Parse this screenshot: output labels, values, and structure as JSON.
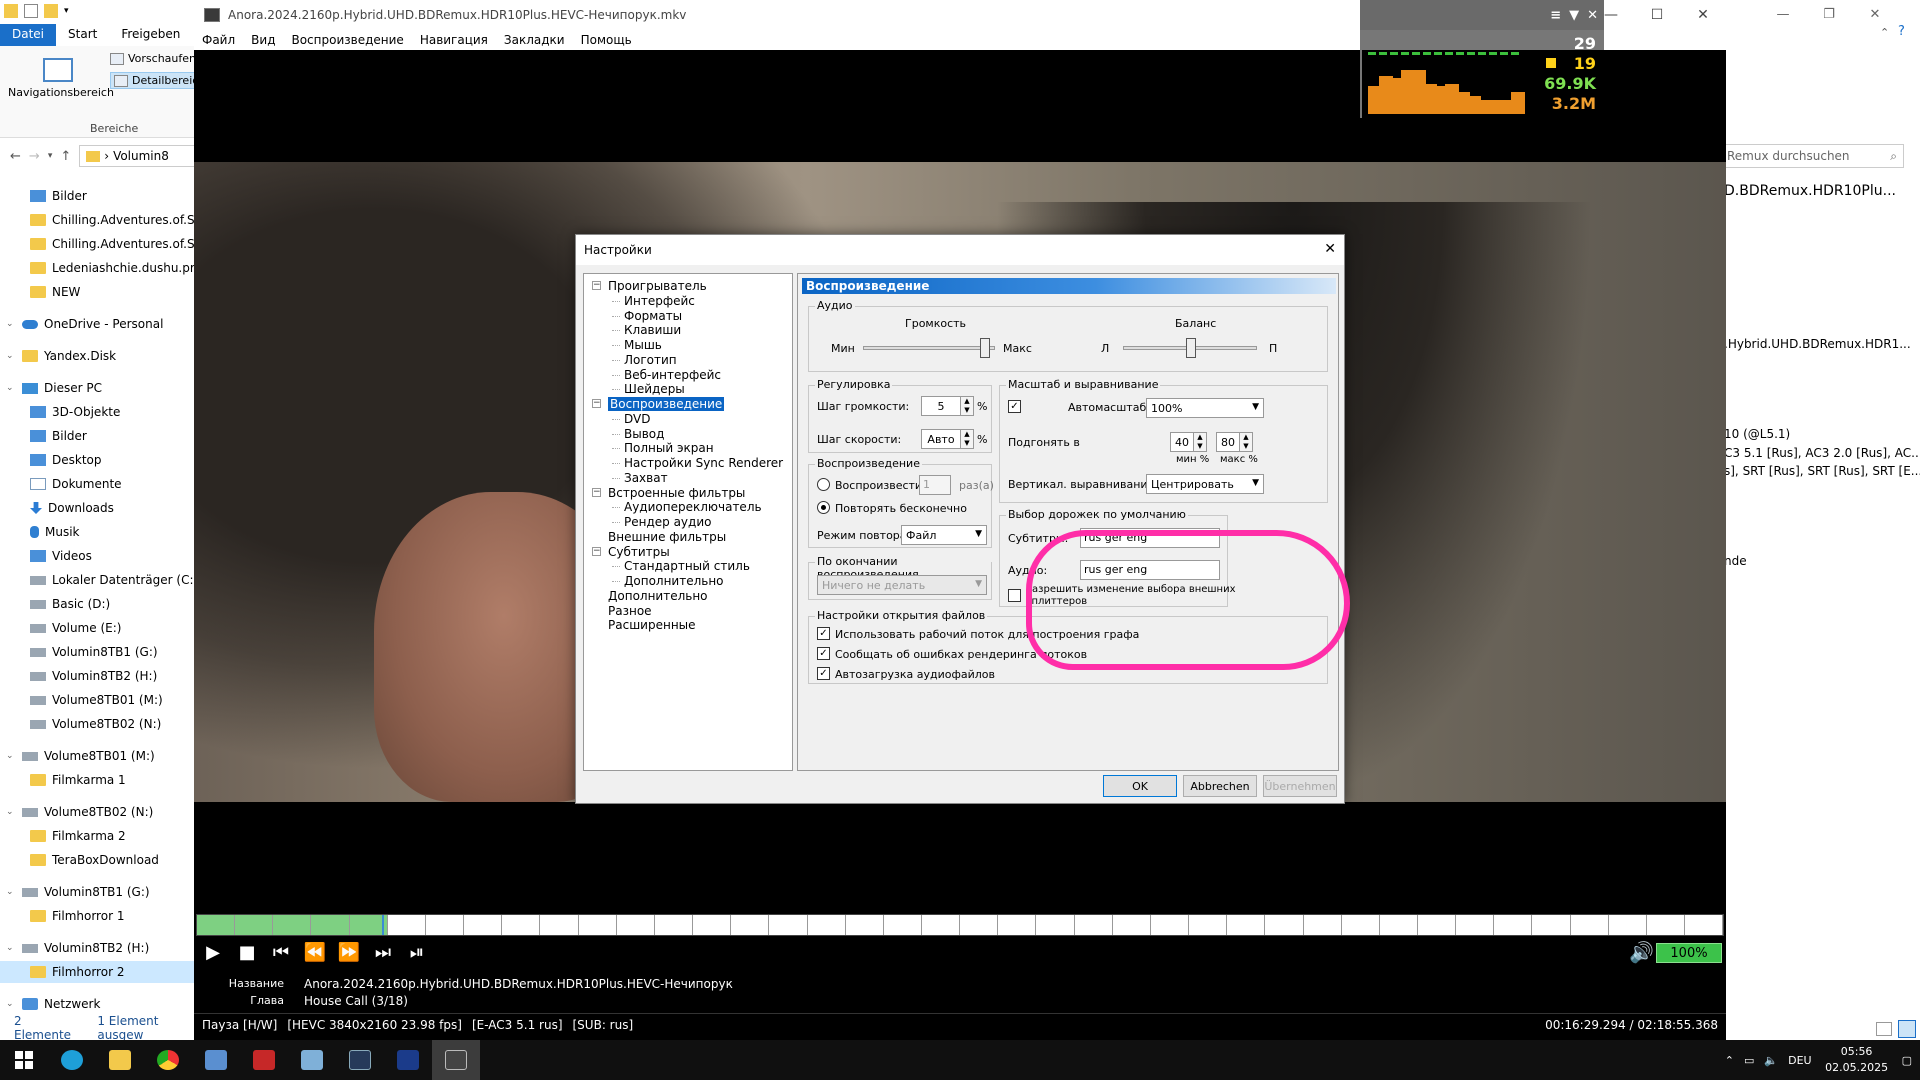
{
  "explorer": {
    "tabs": [
      "Datei",
      "Start",
      "Freigeben"
    ],
    "ribbon": {
      "nav_pane": "Navigationsbereich",
      "preview": "Vorschaufen",
      "details": "Detailbereic",
      "group": "Bereiche"
    },
    "address_crumb": "Volumin8",
    "search_placeholder": "Remux durchsuchen",
    "tree": [
      {
        "label": "Bilder",
        "icon": "pictures-icon"
      },
      {
        "label": "Chilling.Adventures.of.Sab",
        "icon": "folder-icon"
      },
      {
        "label": "Chilling.Adventures.of.Sab",
        "icon": "folder-icon"
      },
      {
        "label": "Ledeniashchie.dushu.prikli",
        "icon": "folder-icon"
      },
      {
        "label": "NEW",
        "icon": "folder-icon"
      },
      {
        "label": "OneDrive - Personal",
        "icon": "cloud-icon"
      },
      {
        "label": "Yandex.Disk",
        "icon": "folder-icon"
      },
      {
        "label": "Dieser PC",
        "icon": "pc-icon"
      },
      {
        "label": "3D-Objekte",
        "icon": "cube-icon"
      },
      {
        "label": "Bilder",
        "icon": "pictures-icon"
      },
      {
        "label": "Desktop",
        "icon": "desktop-icon"
      },
      {
        "label": "Dokumente",
        "icon": "document-icon"
      },
      {
        "label": "Downloads",
        "icon": "download-icon"
      },
      {
        "label": "Musik",
        "icon": "music-icon"
      },
      {
        "label": "Videos",
        "icon": "video-icon"
      },
      {
        "label": "Lokaler Datenträger (C:)",
        "icon": "drive-icon"
      },
      {
        "label": "Basic (D:)",
        "icon": "drive-icon"
      },
      {
        "label": "Volume (E:)",
        "icon": "drive-icon"
      },
      {
        "label": "Volumin8TB1 (G:)",
        "icon": "drive-icon"
      },
      {
        "label": "Volumin8TB2 (H:)",
        "icon": "drive-icon"
      },
      {
        "label": "Volume8TB01 (M:)",
        "icon": "drive-icon"
      },
      {
        "label": "Volume8TB02 (N:)",
        "icon": "drive-icon"
      },
      {
        "label": "Volume8TB01 (M:)",
        "icon": "drive-icon"
      },
      {
        "label": "Filmkarma 1",
        "icon": "folder-icon"
      },
      {
        "label": "Volume8TB02 (N:)",
        "icon": "drive-icon"
      },
      {
        "label": "Filmkarma 2",
        "icon": "folder-icon"
      },
      {
        "label": "TeraBoxDownload",
        "icon": "folder-icon"
      },
      {
        "label": "Volumin8TB1 (G:)",
        "icon": "drive-icon"
      },
      {
        "label": "Filmhorror 1",
        "icon": "folder-icon"
      },
      {
        "label": "Volumin8TB2 (H:)",
        "icon": "drive-icon"
      },
      {
        "label": "Filmhorror 2",
        "icon": "folder-icon"
      },
      {
        "label": "Netzwerk",
        "icon": "network-icon"
      }
    ],
    "status_count": "2 Elemente",
    "status_selected": "1 Element ausgew",
    "right_texts": [
      "D.BDRemux.HDR10Plu...",
      ".Hybrid.UHD.BDRemux.HDR1...",
      "10 (@L5.1)",
      "C3 5.1 [Rus], AC3 2.0 [Rus], AC...",
      "s], SRT [Rus], SRT [Rus], SRT [E...",
      "nde"
    ]
  },
  "player": {
    "title": "Anora.2024.2160p.Hybrid.UHD.BDRemux.HDR10Plus.HEVC-Нечипорук.mkv",
    "menu": [
      "Файл",
      "Вид",
      "Воспроизведение",
      "Навигация",
      "Закладки",
      "Помощь"
    ],
    "stats": {
      "fps": "29",
      "frames": "19",
      "bitrate_a": "69.9K",
      "bitrate_b": "3.2M"
    },
    "seek_progress": 0.121,
    "volume": "100%",
    "info_title_label": "Название",
    "info_title": "Anora.2024.2160p.Hybrid.UHD.BDRemux.HDR10Plus.HEVC-Нечипорук",
    "info_chapter_label": "Глава",
    "info_chapter": "House Call (3/18)",
    "status": [
      "Пауза [H/W]",
      "[HEVC 3840x2160 23.98 fps]",
      "[E-AC3 5.1 rus]",
      "[SUB: rus]"
    ],
    "time": "00:16:29.294 / 02:18:55.368"
  },
  "dialog": {
    "title": "Настройки",
    "tree": [
      {
        "label": "Проигрыватель",
        "level": 0,
        "box": "−"
      },
      {
        "label": "Интерфейс",
        "level": 1
      },
      {
        "label": "Форматы",
        "level": 1
      },
      {
        "label": "Клавиши",
        "level": 1
      },
      {
        "label": "Мышь",
        "level": 1
      },
      {
        "label": "Логотип",
        "level": 1
      },
      {
        "label": "Веб-интерфейс",
        "level": 1
      },
      {
        "label": "Шейдеры",
        "level": 1
      },
      {
        "label": "Воспроизведение",
        "level": 0,
        "box": "−",
        "selected": true
      },
      {
        "label": "DVD",
        "level": 1
      },
      {
        "label": "Вывод",
        "level": 1
      },
      {
        "label": "Полный экран",
        "level": 1
      },
      {
        "label": "Настройки Sync Renderer",
        "level": 1
      },
      {
        "label": "Захват",
        "level": 1
      },
      {
        "label": "Встроенные фильтры",
        "level": 0,
        "box": "−"
      },
      {
        "label": "Аудиопереключатель",
        "level": 1
      },
      {
        "label": "Рендер аудио",
        "level": 1
      },
      {
        "label": "Внешние фильтры",
        "level": 0
      },
      {
        "label": "Субтитры",
        "level": 0,
        "box": "−"
      },
      {
        "label": "Стандартный стиль",
        "level": 1
      },
      {
        "label": "Дополнительно",
        "level": 1
      },
      {
        "label": "Дополнительно",
        "level": 0
      },
      {
        "label": "Разное",
        "level": 0
      },
      {
        "label": "Расширенные",
        "level": 0
      }
    ],
    "header": "Воспроизведение",
    "audio": {
      "group": "Аудио",
      "volume_label": "Громкость",
      "min": "Мин",
      "max": "Макс",
      "balance_label": "Баланс",
      "left": "Л",
      "right": "П",
      "volume_level": 0.95,
      "balance_level": 0.5
    },
    "adjust": {
      "group": "Регулировка",
      "vol_step_label": "Шаг громкости:",
      "vol_step": "5",
      "vol_unit": "%",
      "speed_step_label": "Шаг скорости:",
      "speed_step": "Авто",
      "speed_unit": "%"
    },
    "scale": {
      "group": "Масштаб и выравнивание",
      "autozoom_label": "Автомасштаб:",
      "autozoom_checked": "✓",
      "autozoom": "100%",
      "fit_label": "Подгонять в",
      "fit_min": "40",
      "fit_max": "80",
      "min_label": "мин %",
      "max_label": "макс %",
      "valign_label": "Вертикал. выравнивание:",
      "valign": "Центрировать"
    },
    "playback": {
      "group": "Воспроизведение",
      "play_label": "Воспроизвести",
      "play_times": "1",
      "times_unit": "раз(а)",
      "repeat_forever": "Повторять бесконечно",
      "repeat_mode_label": "Режим повтора:",
      "repeat_mode": "Файл"
    },
    "after": {
      "group": "По окончании воспроизведения",
      "value": "Ничего не делать"
    },
    "tracks": {
      "group": "Выбор дорожек по умолчанию",
      "subs_label": "Субтитры:",
      "subs": "rus ger eng",
      "audio_label": "Аудио:",
      "audio": "rus ger eng",
      "allow_label_1": "Разрешить изменение выбора внешних",
      "allow_label_2": "сплиттеров"
    },
    "open": {
      "group": "Настройки открытия файлов",
      "opt1": "Использовать рабочий поток для построения графа",
      "opt2": "Сообщать об ошибках рендеринга потоков",
      "opt3": "Автозагрузка аудиофайлов",
      "check": "✓"
    },
    "buttons": {
      "ok": "OK",
      "cancel": "Abbrechen",
      "apply": "Übernehmen"
    },
    "highlight_color": "#ff2ea8"
  },
  "taskbar": {
    "lang": "DEU",
    "time": "05:56",
    "date": "02.05.2025"
  }
}
